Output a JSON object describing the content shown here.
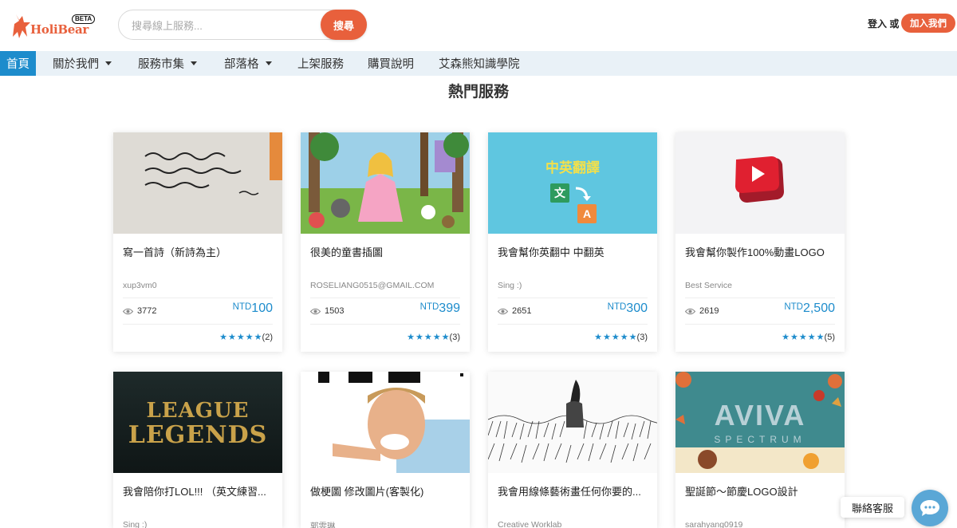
{
  "header": {
    "logo_text": "HoliBear",
    "beta": "BETA",
    "search_placeholder": "搜尋線上服務...",
    "search_button": "搜尋",
    "login": "登入 或",
    "join": "加入我們"
  },
  "nav": {
    "items": [
      {
        "label": "首頁",
        "active": true
      },
      {
        "label": "關於我們",
        "dropdown": true
      },
      {
        "label": "服務市集",
        "dropdown": true
      },
      {
        "label": "部落格",
        "dropdown": true
      },
      {
        "label": "上架服務"
      },
      {
        "label": "購買說明"
      },
      {
        "label": "艾森熊知識學院"
      }
    ]
  },
  "section_title": "熱門服務",
  "cards": [
    {
      "title": "寫一首詩（新詩為主）",
      "seller": "xup3vm0",
      "views": "3772",
      "currency": "NTD",
      "price": "100",
      "rating_count": "(2)"
    },
    {
      "title": "很美的童書插圖",
      "seller": "ROSELIANG0515@GMAIL.COM",
      "views": "1503",
      "currency": "NTD",
      "price": "399",
      "rating_count": "(3)"
    },
    {
      "title": "我會幫你英翻中 中翻英",
      "seller": "Sing :)",
      "views": "2651",
      "currency": "NTD",
      "price": "300",
      "rating_count": "(3)",
      "thumb_text": "中英翻譯",
      "thumb_icon_a": "文",
      "thumb_icon_b": "A"
    },
    {
      "title": "我會幫你製作100%動畫LOGO",
      "seller": "Best Service",
      "views": "2619",
      "currency": "NTD",
      "price": "2,500",
      "rating_count": "(5)"
    },
    {
      "title": "我會陪你打LOL!!! （英文練習...",
      "seller": "Sing :)",
      "thumb_text": "LEAGUE",
      "thumb_text_b": "LEGENDS"
    },
    {
      "title": "做梗圖 修改圖片(客製化)",
      "seller": "郭雯琳"
    },
    {
      "title": "我會用線條藝術畫任何你要的...",
      "seller": "Creative Worklab"
    },
    {
      "title": "聖誕節～節慶LOGO設計",
      "seller": "sarahyang0919",
      "thumb_text": "AVIVA",
      "thumb_text_b": "SPECTRUM"
    }
  ],
  "chat": {
    "label": "聯絡客服"
  },
  "colors": {
    "brand": "#e8603c",
    "accent": "#1d8ccc",
    "nav_bg": "#e9f1f7"
  }
}
